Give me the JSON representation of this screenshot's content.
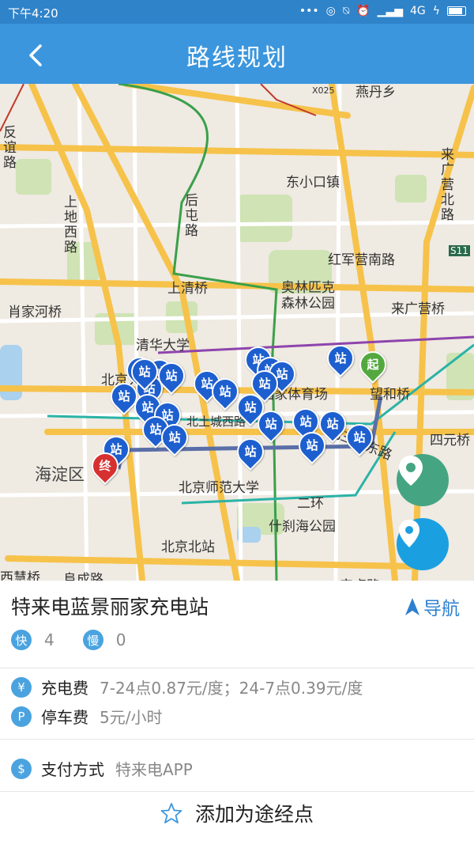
{
  "status_bar": {
    "time": "下午4:20",
    "network": "4G"
  },
  "header": {
    "title": "路线规划"
  },
  "map": {
    "labels": [
      {
        "text": "燕丹乡"
      },
      {
        "text": "X025"
      },
      {
        "text": "东小口镇"
      },
      {
        "text": "来广营北路"
      },
      {
        "text": "红军营南路"
      },
      {
        "text": "S11"
      },
      {
        "text": "上地西路"
      },
      {
        "text": "后屯路"
      },
      {
        "text": "上清桥"
      },
      {
        "text": "奥林匹克森林公园"
      },
      {
        "text": "来广营桥"
      },
      {
        "text": "肖家河桥"
      },
      {
        "text": "清华大学"
      },
      {
        "text": "北京大学"
      },
      {
        "text": "国家体育场"
      },
      {
        "text": "望和桥"
      },
      {
        "text": "北土城西路"
      },
      {
        "text": "北三环东路"
      },
      {
        "text": "四元桥"
      },
      {
        "text": "海淀区"
      },
      {
        "text": "北京师范大学"
      },
      {
        "text": "二环"
      },
      {
        "text": "什刹海公园"
      },
      {
        "text": "北京北站"
      },
      {
        "text": "西慧桥"
      },
      {
        "text": "阜成路"
      },
      {
        "text": "安贞路"
      },
      {
        "text": "反谊路"
      }
    ],
    "pin_label": "站",
    "start_label": "起",
    "end_label": "终",
    "pin_count": 25
  },
  "station": {
    "name": "特来电蓝景丽家充电站",
    "nav_label": "导航",
    "fast_label": "快",
    "fast_count": "4",
    "slow_label": "慢",
    "slow_count": "0",
    "charge_fee_icon": "¥",
    "charge_fee_label": "充电费",
    "charge_fee_value": "7-24点0.87元/度；24-7点0.39元/度",
    "parking_fee_icon": "P",
    "parking_fee_label": "停车费",
    "parking_fee_value": "5元/小时",
    "payment_icon": "$",
    "payment_label": "支付方式",
    "payment_value": "特来电APP",
    "add_waypoint_label": "添加为途经点"
  }
}
